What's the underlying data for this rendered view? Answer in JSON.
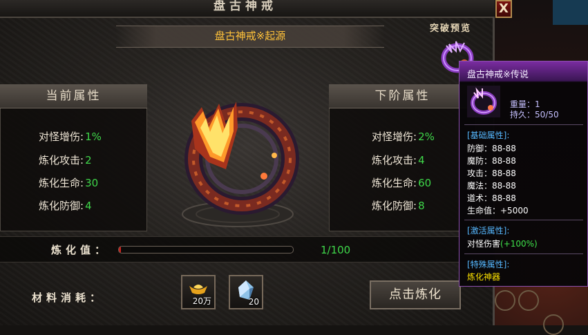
{
  "window": {
    "title": "盘古神戒",
    "close_label": "X"
  },
  "item_title": "盘古神戒※起源",
  "preview_label": "突破预览",
  "current": {
    "header": "当前属性",
    "rows": [
      {
        "label": "对怪增伤:",
        "value": "1%"
      },
      {
        "label": "炼化攻击:",
        "value": "2"
      },
      {
        "label": "炼化生命:",
        "value": "30"
      },
      {
        "label": "炼化防御:",
        "value": "4"
      }
    ]
  },
  "next": {
    "header": "下阶属性",
    "rows": [
      {
        "label": "对怪增伤:",
        "value": "2%"
      },
      {
        "label": "炼化攻击:",
        "value": "4"
      },
      {
        "label": "炼化生命:",
        "value": "60"
      },
      {
        "label": "炼化防御:",
        "value": "8"
      }
    ]
  },
  "progress": {
    "label": "炼化值：",
    "current": 1,
    "max": 100,
    "text": "1/100",
    "fraction": 0.01
  },
  "materials": {
    "label": "材料消耗：",
    "items": [
      {
        "icon": "gold-ingot-icon",
        "count": "20万"
      },
      {
        "icon": "crystal-icon",
        "count": "20"
      }
    ]
  },
  "refine_button": "点击炼化",
  "tooltip": {
    "title": "盘古神戒※传说",
    "weight": "重量：1",
    "durability": "持久：50/50",
    "base_header": "[基础属性]:",
    "base_stats": [
      "防御：88-88",
      "魔防：88-88",
      "攻击：88-88",
      "魔法：88-88",
      "道术：88-88",
      "生命值：+5000"
    ],
    "active_header": "[激活属性]:",
    "active_label": "对怪伤害",
    "active_value": "(+100%)",
    "special_header": "[特殊属性]:",
    "special_text": "炼化神器"
  },
  "colors": {
    "gold": "#ffc23a",
    "green": "#3fd84a",
    "progress_red": "#c9241e",
    "tooltip_purple": "#7a2ca0"
  }
}
